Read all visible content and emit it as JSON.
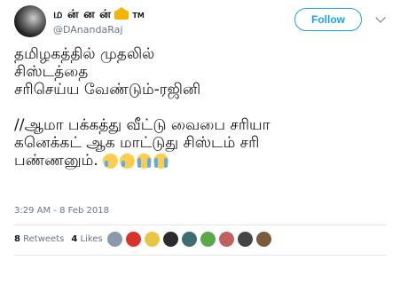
{
  "user": {
    "display_name": "ம ன் ன ன்",
    "tm": "TM",
    "handle": "@DAnandaRaj",
    "crown_icon": "crown-icon"
  },
  "follow_label": "Follow",
  "tweet": {
    "lines_1": [
      "தமிழகத்தில் முதலில்",
      "சிஸ்டத்தை",
      "சரிசெய்ய வேண்டும்-ரஜினி"
    ],
    "lines_2": [
      "//ஆமா பக்கத்து வீட்டு வைபை சரியா",
      "கனெக்கட் ஆக மாட்டுது சிஸ்டம் சரி"
    ],
    "last_line": "பண்ணனும்.",
    "emojis": [
      "crying-face-icon",
      "crying-face-icon",
      "sob-face-icon",
      "sob-face-icon"
    ]
  },
  "timestamp": "3:29 AM - 8 Feb 2018",
  "stats": {
    "retweets_count": "8",
    "retweets_label": "Retweets",
    "likes_count": "4",
    "likes_label": "Likes"
  },
  "liker_colors": [
    "#8a9aa8",
    "#d9342b",
    "#e8c547",
    "#2b2b2b",
    "#3c6e71",
    "#5aa84a",
    "#c06060",
    "#444444",
    "#7a5a3a"
  ]
}
